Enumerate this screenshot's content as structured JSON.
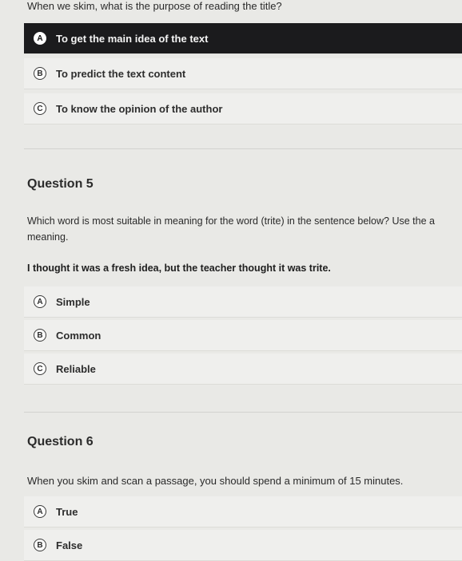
{
  "question4": {
    "prompt": "When we skim, what is the purpose of reading the title?",
    "options": [
      {
        "letter": "A",
        "label": "To get the main idea of the text",
        "selected": true
      },
      {
        "letter": "B",
        "label": "To predict the text content",
        "selected": false
      },
      {
        "letter": "C",
        "label": "To know the opinion of the author",
        "selected": false
      }
    ]
  },
  "question5": {
    "heading": "Question 5",
    "prompt_line1": "Which word is most suitable in meaning for the word (trite) in the sentence below? Use the a",
    "prompt_line2": "meaning.",
    "sentence": "I thought it was a fresh idea, but the teacher thought it was trite.",
    "options": [
      {
        "letter": "A",
        "label": "Simple"
      },
      {
        "letter": "B",
        "label": "Common"
      },
      {
        "letter": "C",
        "label": "Reliable"
      }
    ]
  },
  "question6": {
    "heading": "Question 6",
    "prompt": "When you skim and scan a passage, you should spend a minimum of 15 minutes.",
    "options": [
      {
        "letter": "A",
        "label": "True"
      },
      {
        "letter": "B",
        "label": "False"
      }
    ]
  },
  "colors": {
    "selected_bg": "#1b1b1d",
    "option_bg": "#efefed",
    "page_bg": "#e9e9e6"
  }
}
